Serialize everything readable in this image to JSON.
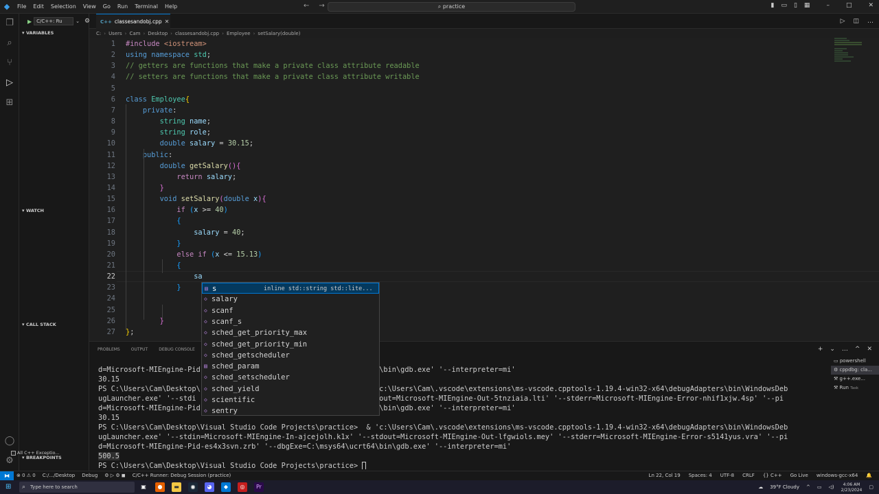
{
  "titlebar": {
    "menu": [
      "File",
      "Edit",
      "Selection",
      "View",
      "Go",
      "Run",
      "Terminal",
      "Help"
    ],
    "command_center": "practice"
  },
  "sidebar": {
    "config": "C/C++: Ru",
    "sections": [
      "VARIABLES",
      "WATCH",
      "CALL STACK",
      "BREAKPOINTS"
    ],
    "breakpoint_item": "All C++ Exceptio..."
  },
  "tab": {
    "label": "classesandobj.cpp"
  },
  "breadcrumb": [
    "C:",
    "Users",
    "Cam",
    "Desktop",
    "classesandobj.cpp",
    "Employee",
    "setSalary(double)"
  ],
  "editor": {
    "lines": [
      {
        "n": "1",
        "html": "<span class=\"p\">#include</span> <span class=\"s\">&lt;iostream&gt;</span>"
      },
      {
        "n": "2",
        "html": "<span class=\"k\">using</span> <span class=\"k\">namespace</span> <span class=\"t\">std</span>;"
      },
      {
        "n": "3",
        "html": "<span class=\"c\">// getters are functions that make a private class attribute readable</span>"
      },
      {
        "n": "4",
        "html": "<span class=\"c\">// setters are functions that make a private class attribute writable</span>"
      },
      {
        "n": "5",
        "html": ""
      },
      {
        "n": "6",
        "html": "<span class=\"k\">class</span> <span class=\"t\">Employee</span><span class=\"b1\">{</span>"
      },
      {
        "n": "7",
        "html": "    <span class=\"k\">private</span>:"
      },
      {
        "n": "8",
        "html": "        <span class=\"t\">string</span> <span class=\"v\">name</span>;"
      },
      {
        "n": "9",
        "html": "        <span class=\"t\">string</span> <span class=\"v\">role</span>;"
      },
      {
        "n": "10",
        "html": "        <span class=\"k\">double</span> <span class=\"v\">salary</span> = <span class=\"n\">30.15</span>;"
      },
      {
        "n": "11",
        "html": "    <span class=\"k\">public</span>:"
      },
      {
        "n": "12",
        "html": "        <span class=\"k\">double</span> <span class=\"f\">getSalary</span><span class=\"b2\">()</span><span class=\"b2\">{</span>"
      },
      {
        "n": "13",
        "html": "            <span class=\"p\">return</span> <span class=\"v\">salary</span>;"
      },
      {
        "n": "14",
        "html": "        <span class=\"b2\">}</span>"
      },
      {
        "n": "15",
        "html": "        <span class=\"k\">void</span> <span class=\"f\">setSalary</span><span class=\"b2\">(</span><span class=\"k\">double</span> <span class=\"v\">x</span><span class=\"b2\">)</span><span class=\"b2\">{</span>"
      },
      {
        "n": "16",
        "html": "            <span class=\"p\">if</span> <span class=\"b3\">(</span><span class=\"v\">x</span> &gt;= <span class=\"n\">40</span><span class=\"b3\">)</span>"
      },
      {
        "n": "17",
        "html": "            <span class=\"b3\">{</span>"
      },
      {
        "n": "18",
        "html": "                <span class=\"v\">salary</span> = <span class=\"n\">40</span>;"
      },
      {
        "n": "19",
        "html": "            <span class=\"b3\">}</span>"
      },
      {
        "n": "20",
        "html": "            <span class=\"p\">else</span> <span class=\"p\">if</span> <span class=\"b3\">(</span><span class=\"v\">x</span> &lt;= <span class=\"n\">15.13</span><span class=\"b3\">)</span>"
      },
      {
        "n": "21",
        "html": "            <span class=\"b3\">{</span>"
      },
      {
        "n": "22",
        "html": "                <span class=\"v\">sa</span>"
      },
      {
        "n": "23",
        "html": "            <span class=\"b3\">}</span>"
      },
      {
        "n": "24",
        "html": ""
      },
      {
        "n": "25",
        "html": ""
      },
      {
        "n": "26",
        "html": "        <span class=\"b2\">}</span>"
      },
      {
        "n": "27",
        "html": "<span class=\"b1\">}</span>;"
      }
    ]
  },
  "suggest": {
    "items": [
      {
        "label": "s",
        "detail": "inline std::string std::lite..."
      },
      {
        "label": "salary",
        "detail": ""
      },
      {
        "label": "scanf",
        "detail": ""
      },
      {
        "label": "scanf_s",
        "detail": ""
      },
      {
        "label": "sched_get_priority_max",
        "detail": ""
      },
      {
        "label": "sched_get_priority_min",
        "detail": ""
      },
      {
        "label": "sched_getscheduler",
        "detail": ""
      },
      {
        "label": "sched_param",
        "detail": ""
      },
      {
        "label": "sched_setscheduler",
        "detail": ""
      },
      {
        "label": "sched_yield",
        "detail": ""
      },
      {
        "label": "scientific",
        "detail": ""
      },
      {
        "label": "sentry",
        "detail": ""
      }
    ]
  },
  "panel": {
    "tabs": [
      "PROBLEMS",
      "OUTPUT",
      "DEBUG CONSOLE"
    ],
    "terminal_lines": [
      "d=Microsoft-MIEngine-Pid-                                         \\bin\\gdb.exe' '--interpreter=mi'",
      "30.15",
      "PS C:\\Users\\Cam\\Desktop\\                                       & 'c:\\Users\\Cam\\.vscode\\extensions\\ms-vscode.cpptools-1.19.4-win32-x64\\debugAdapters\\bin\\WindowsDeb",
      "ugLauncher.exe' '--stdi                                       -stdout=Microsoft-MIEngine-Out-5tnziaia.lti' '--stderr=Microsoft-MIEngine-Error-nhif1xjw.4sp' '--pi",
      "d=Microsoft-MIEngine-Pid-                                         \\bin\\gdb.exe' '--interpreter=mi'",
      "30.15",
      "PS C:\\Users\\Cam\\Desktop\\Visual Studio Code Projects\\practice>  & 'c:\\Users\\Cam\\.vscode\\extensions\\ms-vscode.cpptools-1.19.4-win32-x64\\debugAdapters\\bin\\WindowsDeb",
      "ugLauncher.exe' '--stdin=Microsoft-MIEngine-In-ajcejolh.k1x' '--stdout=Microsoft-MIEngine-Out-lfgwiols.mey' '--stderr=Microsoft-MIEngine-Error-s5141yus.vra' '--pi",
      "d=Microsoft-MIEngine-Pid-es4x3svn.zrb' '--dbgExe=C:\\msys64\\ucrt64\\bin\\gdb.exe' '--interpreter=mi'",
      "500.5",
      "PS C:\\Users\\Cam\\Desktop\\Visual Studio Code Projects\\practice> "
    ],
    "terminals": [
      {
        "label": "powershell",
        "sub": ""
      },
      {
        "label": "cppdbg: cla...",
        "sub": ""
      },
      {
        "label": "g++.exe...",
        "sub": ""
      },
      {
        "label": "Run",
        "sub": "Task"
      }
    ]
  },
  "status": {
    "left": [
      "⊗ 0  ⚠ 0",
      "C:/.../Desktop",
      "Debug",
      "C/C++ Runner: Debug Session (practice)"
    ],
    "right": [
      "Ln 22, Col 19",
      "Spaces: 4",
      "UTF-8",
      "CRLF",
      "{} C++",
      "Go Live",
      "windows-gcc-x64"
    ]
  },
  "taskbar": {
    "search_placeholder": "Type here to search",
    "weather": "39°F  Cloudy",
    "time": "4:06 AM",
    "date": "2/23/2024"
  }
}
